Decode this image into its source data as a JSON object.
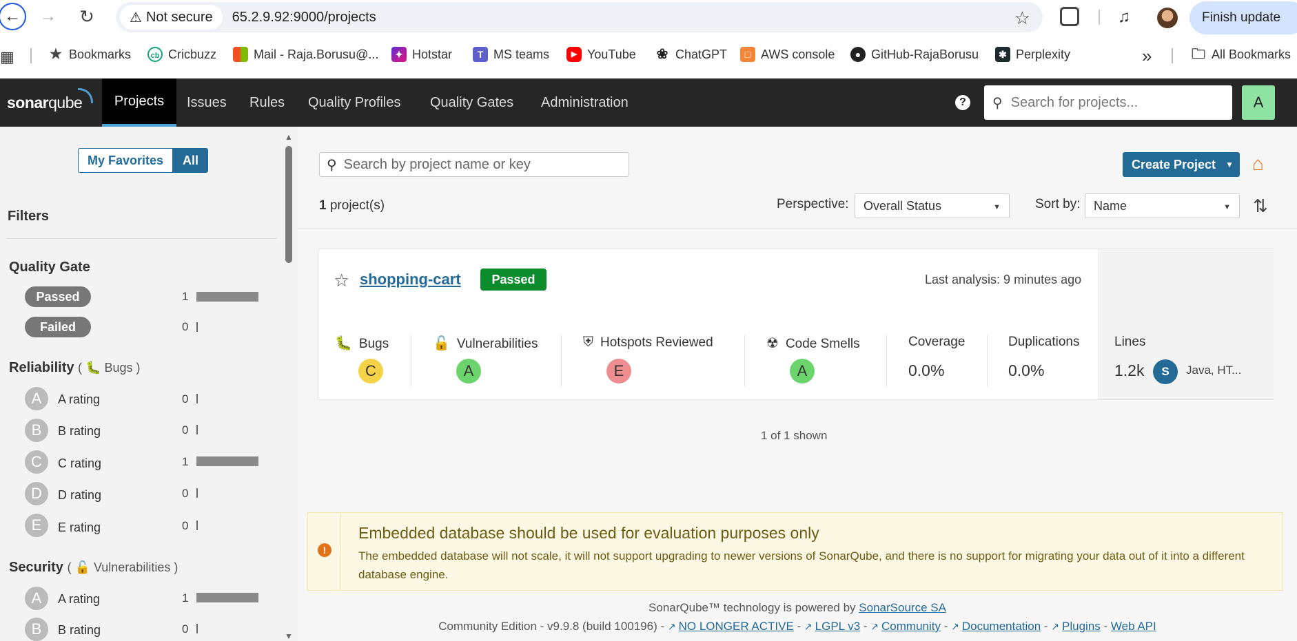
{
  "browser": {
    "security_label": "Not secure",
    "url": "65.2.9.92:9000/projects",
    "update_label": "Finish update",
    "bookmarks": [
      {
        "label": "Bookmarks",
        "icon": "star-icon"
      },
      {
        "label": "Cricbuzz",
        "icon": "cricbuzz-icon"
      },
      {
        "label": "Mail - Raja.Borusu@...",
        "icon": "microsoft-icon"
      },
      {
        "label": "Hotstar",
        "icon": "hotstar-icon"
      },
      {
        "label": "MS teams",
        "icon": "teams-icon"
      },
      {
        "label": "YouTube",
        "icon": "youtube-icon"
      },
      {
        "label": "ChatGPT",
        "icon": "chatgpt-icon"
      },
      {
        "label": "AWS console",
        "icon": "aws-icon"
      },
      {
        "label": "GitHub-RajaBorusu",
        "icon": "github-icon"
      },
      {
        "label": "Perplexity",
        "icon": "perplexity-icon"
      },
      {
        "label": "All Bookmarks",
        "icon": "folder-icon"
      }
    ]
  },
  "nav": {
    "logo_bold": "sonar",
    "logo_thin": "qube",
    "tabs": [
      "Projects",
      "Issues",
      "Rules",
      "Quality Profiles",
      "Quality Gates",
      "Administration"
    ],
    "search_placeholder": "Search for projects...",
    "avatar": "A"
  },
  "sidebar": {
    "my_favorites": "My Favorites",
    "all": "All",
    "filters_title": "Filters",
    "quality_gate": {
      "title": "Quality Gate",
      "items": [
        {
          "label": "Passed",
          "count": "1",
          "fill": 1.0
        },
        {
          "label": "Failed",
          "count": "0",
          "fill": 0.0
        }
      ]
    },
    "reliability": {
      "title": "Reliability",
      "sub": "Bugs",
      "items": [
        {
          "grade": "A",
          "label": "A rating",
          "count": "0",
          "fill": 0.0
        },
        {
          "grade": "B",
          "label": "B rating",
          "count": "0",
          "fill": 0.0
        },
        {
          "grade": "C",
          "label": "C rating",
          "count": "1",
          "fill": 1.0
        },
        {
          "grade": "D",
          "label": "D rating",
          "count": "0",
          "fill": 0.0
        },
        {
          "grade": "E",
          "label": "E rating",
          "count": "0",
          "fill": 0.0
        }
      ]
    },
    "security": {
      "title": "Security",
      "sub": "Vulnerabilities",
      "items": [
        {
          "grade": "A",
          "label": "A rating",
          "count": "1",
          "fill": 1.0
        },
        {
          "grade": "B",
          "label": "B rating",
          "count": "0",
          "fill": 0.0
        }
      ]
    }
  },
  "main": {
    "search_placeholder": "Search by project name or key",
    "create_button": "Create Project",
    "project_count_num": "1",
    "project_count_text": "project(s)",
    "perspective_label": "Perspective:",
    "perspective_value": "Overall Status",
    "sort_label": "Sort by:",
    "sort_value": "Name",
    "shown": "1 of 1 shown"
  },
  "project": {
    "name": "shopping-cart",
    "status": "Passed",
    "last_analysis": "Last analysis: 9 minutes ago",
    "metrics": {
      "bugs_label": "Bugs",
      "bugs_grade": "C",
      "vuln_label": "Vulnerabilities",
      "vuln_grade": "A",
      "hotspots_label": "Hotspots Reviewed",
      "hotspots_grade": "E",
      "smells_label": "Code Smells",
      "smells_grade": "A",
      "coverage_label": "Coverage",
      "coverage_value": "0.0%",
      "dup_label": "Duplications",
      "dup_value": "0.0%",
      "lines_label": "Lines",
      "lines_value": "1.2k",
      "lang_badge": "S",
      "languages": "Java, HT..."
    }
  },
  "notice": {
    "title": "Embedded database should be used for evaluation purposes only",
    "text": "The embedded database will not scale, it will not support upgrading to newer versions of SonarQube, and there is no support for migrating your data out of it into a different database engine."
  },
  "footer": {
    "powered_prefix": "SonarQube™ technology is powered by",
    "powered_link": "SonarSource SA",
    "edition": "Community Edition - v9.9.8 (build 100196) -",
    "links": [
      "NO LONGER ACTIVE",
      "LGPL v3",
      "Community",
      "Documentation",
      "Plugins",
      "Web API"
    ]
  },
  "colors": {
    "accent": "#236a97",
    "passed": "#0a8c2d",
    "home": "#e3731b"
  }
}
